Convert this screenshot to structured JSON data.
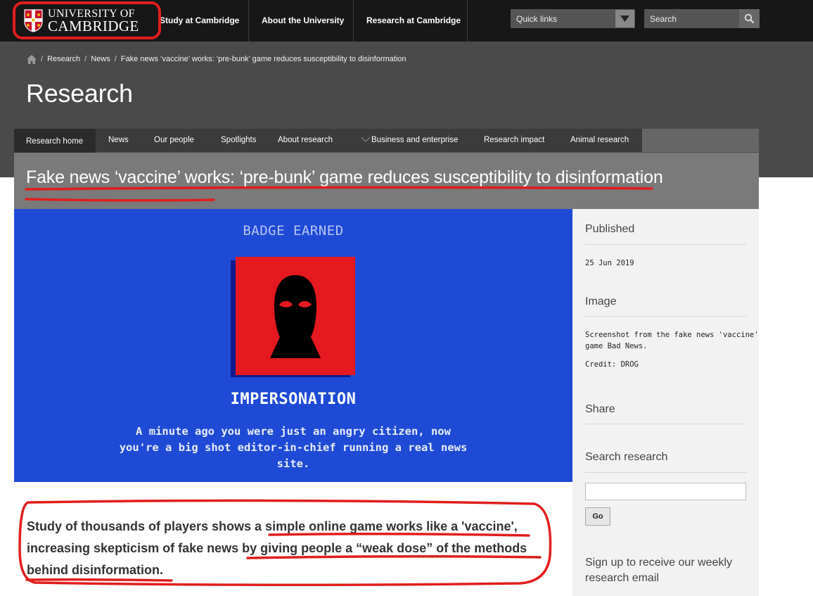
{
  "header": {
    "logo_line1": "UNIVERSITY OF",
    "logo_line2": "CAMBRIDGE",
    "nav": [
      "Study at Cambridge",
      "About the University",
      "Research at Cambridge"
    ],
    "quick_links_label": "Quick links",
    "search_label": "Search"
  },
  "breadcrumb": [
    "Research",
    "News",
    "Fake news ‘vaccine’ works: ‘pre-bunk’ game reduces susceptibility to disinformation"
  ],
  "section_title": "Research",
  "subnav": {
    "items": [
      "Research home",
      "News",
      "Our people",
      "Spotlights",
      "About research",
      "Business and enterprise",
      "Research impact",
      "Animal research"
    ],
    "active": "Research home"
  },
  "article": {
    "title": "Fake news ‘vaccine’ works: ‘pre-bunk’ game reduces susceptibility to disinformation",
    "summary_lines": [
      "Study of thousands of players shows a simple online game works like a 'vaccine',",
      "increasing skepticism of fake news by giving people a “weak dose” of the methods",
      "behind disinformation."
    ]
  },
  "hero_image": {
    "badge": "BADGE EARNED",
    "name": "IMPERSONATION",
    "description_lines": [
      "A minute ago you were just an angry citizen, now",
      "you're a big shot editor-in-chief running a real news",
      "site."
    ],
    "colors": {
      "background": "#1e4ad6",
      "badge_red": "#e5191f"
    }
  },
  "sidebar": {
    "published_heading": "Published",
    "published_date": "25 Jun 2019",
    "image_heading": "Image",
    "image_caption_lines": [
      "Screenshot from the fake news 'vaccine'",
      "game Bad News."
    ],
    "image_credit": "Credit: DROG",
    "share_heading": "Share",
    "search_heading": "Search research",
    "search_value": "",
    "go_label": "Go",
    "signup_lines": [
      "Sign up to receive our weekly",
      "research email"
    ]
  },
  "annotation_color": "#e11d1d"
}
